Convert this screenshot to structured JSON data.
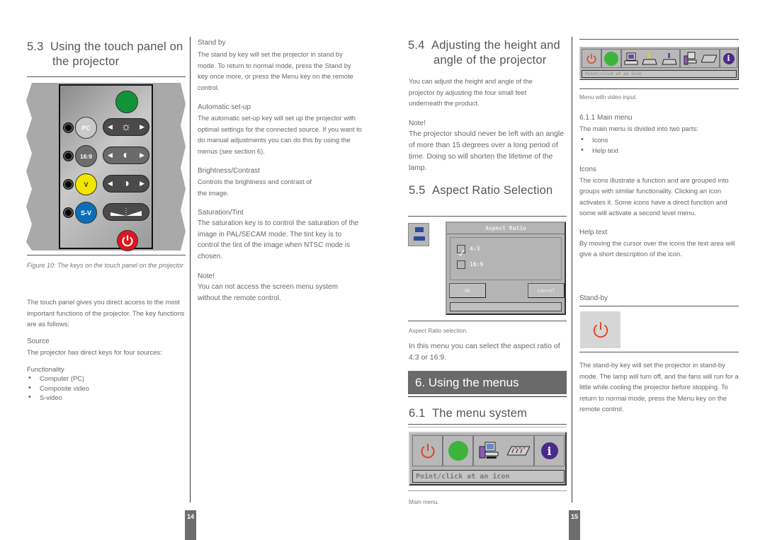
{
  "left_page": {
    "col1": {
      "section_number": "5.3",
      "section_title_line1": "Using the touch panel on",
      "section_title_line2": "the projector",
      "figure_caption": "Figure 10: The keys on the touch panel on the projector",
      "intro": "The touch panel gives you direct access to the most important functions of the projector. The key functions are as follows:",
      "source_heading": "Source",
      "source_text": "The projector has direct keys for four sources:",
      "functionality_heading": "Functionality",
      "functionality_items": [
        "Computer (PC)",
        "Composite video",
        "S-video"
      ]
    },
    "touch_panel": {
      "keys": {
        "pc": "PC",
        "ratio": "16:9",
        "video": "V",
        "svideo": "S-V"
      },
      "colors": {
        "green_key": "#12933a",
        "pc_key": "#c9c9c9",
        "ratio_key": "#6d6d6d",
        "video_key": "#f2e600",
        "svideo_key": "#0b6fb8",
        "standby_key": "#e0161e"
      }
    },
    "col2": {
      "standby_heading": "Stand by",
      "standby_text": "The stand by key will set the projector in stand by mode. To return to normal mode, press the Stand by key once more, or press the Menu key on the remote control.",
      "autosetup_heading": "Automatic set-up",
      "autosetup_text": "The automatic set-up key will set up the projector with optimal settings for the connected source. If you want to do manual adjustments you can do this by using the menus (see section 6).",
      "brightness_heading": "Brightness/Contrast",
      "brightness_text": "Controls the brightness and contrast of the image.",
      "saturation_heading": "Saturation/Tint",
      "saturation_text": "The saturation key is to control the saturation of the image in PAL/SECAM mode. The tint key is to control the tint of the image when NTSC mode is chosen.",
      "note_heading": "Note!",
      "note_text": "You can not access the screen menu system without the remote control."
    },
    "page_number": "14"
  },
  "right_page": {
    "col1": {
      "s54_number": "5.4",
      "s54_title_line1": "Adjusting the height and",
      "s54_title_line2": "angle of the projector",
      "s54_text": "You can adjust the height and angle of the projector by adjusting the four small feet underneath the product.",
      "note_heading": "Note!",
      "note_text": "The projector should never be left with an angle of more than 15 degrees over a long period of time. Doing so will shorten the lifetime of the lamp.",
      "s55_number": "5.5",
      "s55_title": "Aspect Ratio Selection",
      "aspect_dialog": {
        "title": "Aspect Ratio",
        "options": [
          {
            "label": "4:3",
            "checked": true
          },
          {
            "label": "16:9",
            "checked": false
          }
        ],
        "ok_label": "OK",
        "cancel_label": "Cancel",
        "icon_top": "4:3",
        "icon_bottom": "16:9"
      },
      "aspect_caption": "Aspect Ratio selection.",
      "aspect_text": "In this menu you can select the aspect ratio of 4:3 or 16:9.",
      "chapter_title": "6. Using the menus",
      "s61_number": "6.1",
      "s61_title": "The menu system",
      "main_menu_help": "Point/click at an icon",
      "main_menu_caption": "Main menu."
    },
    "col2": {
      "video_menu_help": "Point/click at an icon",
      "video_menu_caption": "Menu with video input.",
      "s611_heading": "6.1.1 Main menu",
      "s611_text": "The main menu is divided into two parts:",
      "s611_items": [
        "Icons",
        "Help text"
      ],
      "icons_heading": "Icons",
      "icons_text": "The icons illustrate a function and are grouped into groups with similar functionality. Clicking an icon activates it. Some icons have a direct function and some will activate a second level menu.",
      "helptext_heading": "Help text",
      "helptext_text": "By moving the cursor over the icons the text area will give a short description of the icon.",
      "standby_heading": "Stand-by",
      "standby_text": "The stand-by key will set the projector in stand-by mode. The lamp will turn off, and the fans will run for a little while cooling the projector before stopping. To return to normal mode, press the Menu key on the remote control."
    },
    "page_number": "15"
  },
  "colors": {
    "standby_icon": "#e0461e",
    "green_icon": "#3cb43c",
    "info_icon": "#4a2a8c",
    "chapter_bar": "#6a6a6a"
  }
}
